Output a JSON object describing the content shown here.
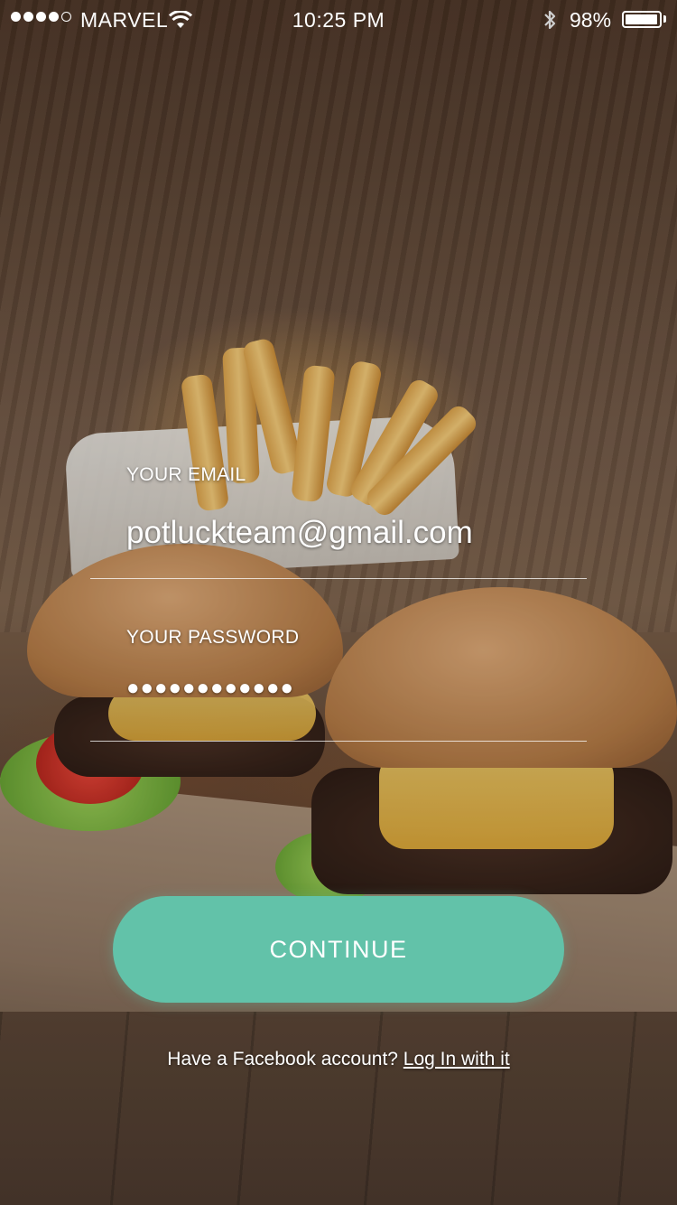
{
  "status_bar": {
    "carrier": "MARVEL",
    "time": "10:25 PM",
    "battery_percent": "98%",
    "battery_level": 0.98,
    "signal_bars_filled": 4,
    "signal_bars_total": 5,
    "icons": [
      "signal-dots-icon",
      "wifi-icon",
      "bluetooth-icon",
      "battery-icon"
    ]
  },
  "login_form": {
    "email_label": "YOUR EMAIL",
    "email_value": "potluckteam@gmail.com",
    "password_label": "YOUR PASSWORD",
    "password_masked": "●●●●●●●●●●●●"
  },
  "continue_button": {
    "label": "CONTINUE",
    "color": "#62c2a9"
  },
  "facebook": {
    "prompt": "Have a Facebook account?",
    "link_label": "Log In with it"
  },
  "background": {
    "description_icon": "burger-fries-photo"
  }
}
